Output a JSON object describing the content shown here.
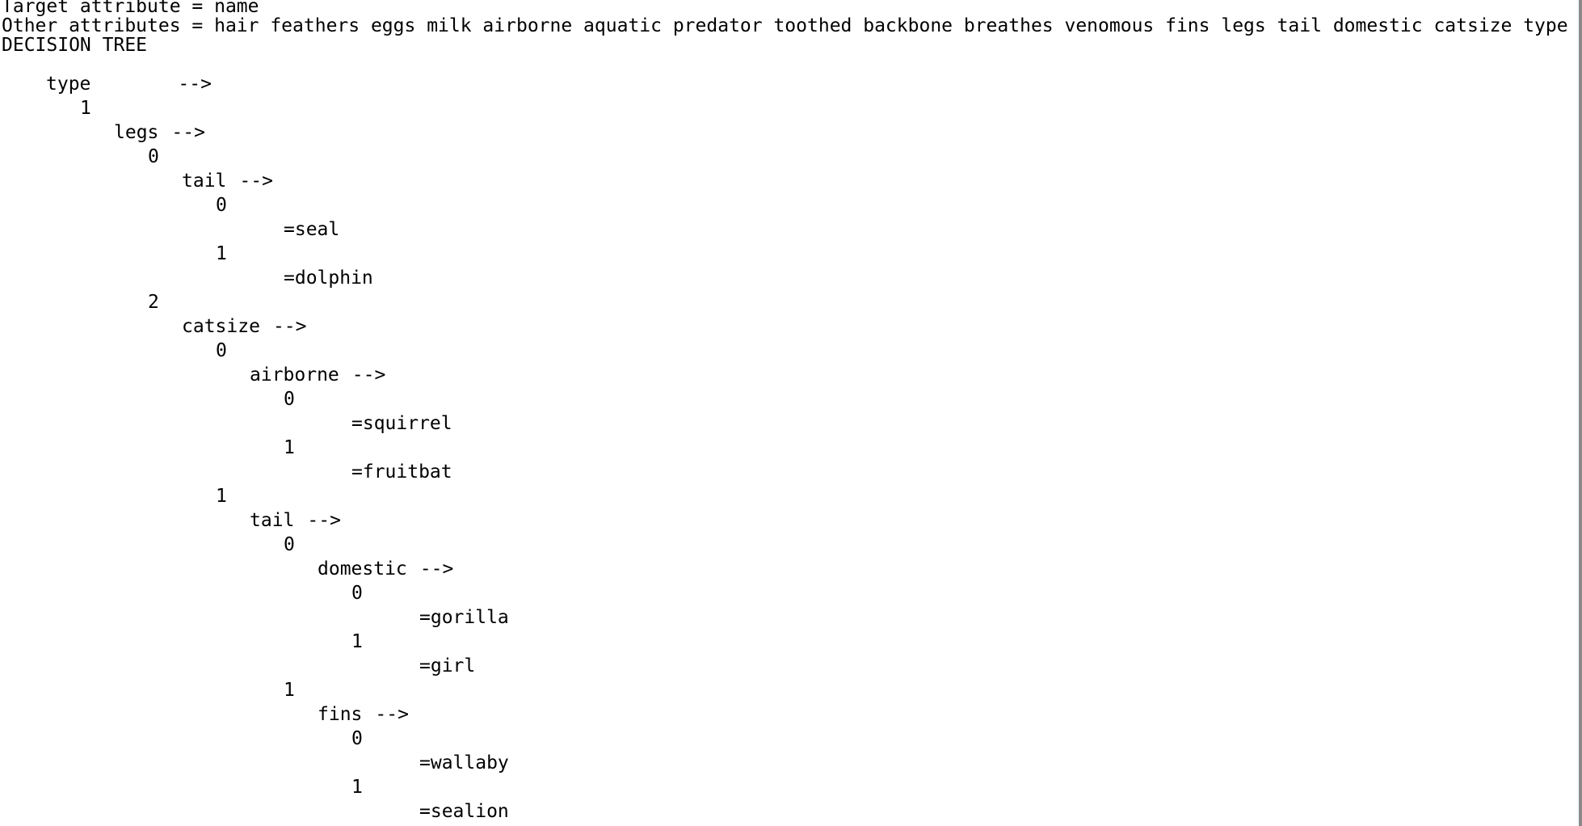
{
  "console": {
    "target_line": "Target attribute = name",
    "other_line": "Other attributes = hair feathers eggs milk airborne aquatic predator toothed backbone breathes venomous fins legs tail domestic catsize type",
    "tree_header": "DECISION TREE",
    "arrow": "-->",
    "tree": [
      {
        "text": "type",
        "kind": "attr",
        "depth": 0
      },
      {
        "text": "1",
        "kind": "value",
        "depth": 1
      },
      {
        "text": "legs",
        "kind": "attr",
        "depth": 2
      },
      {
        "text": "0",
        "kind": "value",
        "depth": 3
      },
      {
        "text": "tail",
        "kind": "attr",
        "depth": 4
      },
      {
        "text": "0",
        "kind": "value",
        "depth": 5
      },
      {
        "text": "=seal",
        "kind": "leaf",
        "depth": 7
      },
      {
        "text": "1",
        "kind": "value",
        "depth": 5
      },
      {
        "text": "=dolphin",
        "kind": "leaf",
        "depth": 7
      },
      {
        "text": "2",
        "kind": "value",
        "depth": 3
      },
      {
        "text": "catsize",
        "kind": "attr",
        "depth": 4
      },
      {
        "text": "0",
        "kind": "value",
        "depth": 5
      },
      {
        "text": "airborne",
        "kind": "attr",
        "depth": 6
      },
      {
        "text": "0",
        "kind": "value",
        "depth": 7
      },
      {
        "text": "=squirrel",
        "kind": "leaf",
        "depth": 9
      },
      {
        "text": "1",
        "kind": "value",
        "depth": 7
      },
      {
        "text": "=fruitbat",
        "kind": "leaf",
        "depth": 9
      },
      {
        "text": "1",
        "kind": "value",
        "depth": 5
      },
      {
        "text": "tail",
        "kind": "attr",
        "depth": 6
      },
      {
        "text": "0",
        "kind": "value",
        "depth": 7
      },
      {
        "text": "domestic",
        "kind": "attr",
        "depth": 8
      },
      {
        "text": "0",
        "kind": "value",
        "depth": 9
      },
      {
        "text": "=gorilla",
        "kind": "leaf",
        "depth": 11
      },
      {
        "text": "1",
        "kind": "value",
        "depth": 9
      },
      {
        "text": "=girl",
        "kind": "leaf",
        "depth": 11
      },
      {
        "text": "1",
        "kind": "value",
        "depth": 7
      },
      {
        "text": "fins",
        "kind": "attr",
        "depth": 8
      },
      {
        "text": "0",
        "kind": "value",
        "depth": 9
      },
      {
        "text": "=wallaby",
        "kind": "leaf",
        "depth": 11
      },
      {
        "text": "1",
        "kind": "value",
        "depth": 9
      },
      {
        "text": "=sealion",
        "kind": "leaf",
        "depth": 11
      }
    ]
  }
}
